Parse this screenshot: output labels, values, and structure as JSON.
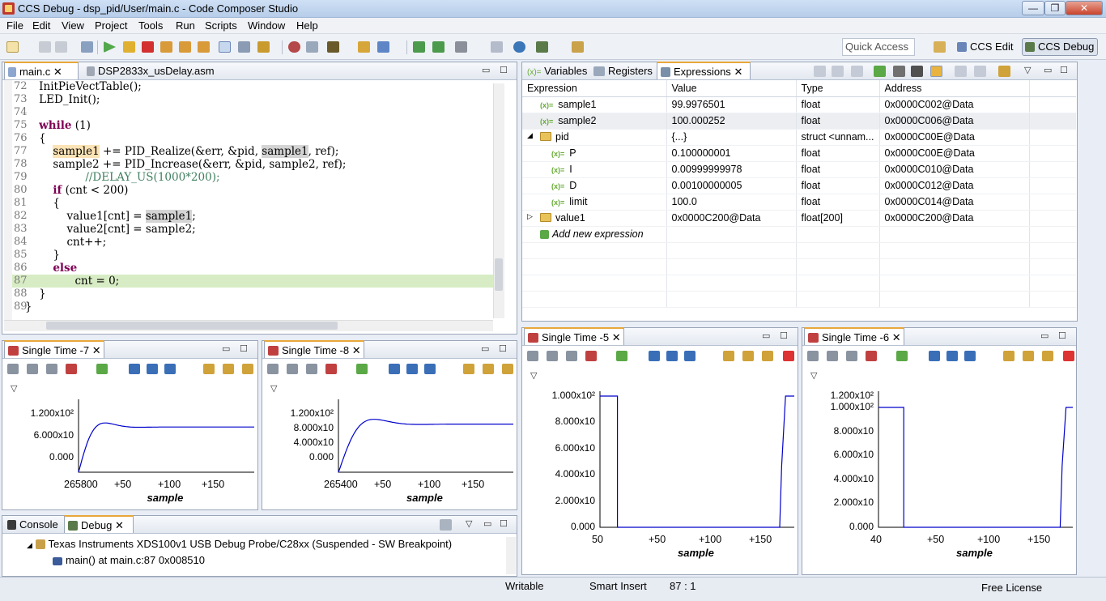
{
  "window": {
    "title": "CCS Debug - dsp_pid/User/main.c - Code Composer Studio"
  },
  "menu": [
    "File",
    "Edit",
    "View",
    "Project",
    "Tools",
    "Run",
    "Scripts",
    "Window",
    "Help"
  ],
  "quick_access": {
    "placeholder": "Quick Access"
  },
  "perspectives": {
    "edit": "CCS Edit",
    "debug": "CCS Debug"
  },
  "editor": {
    "tabs": [
      "main.c",
      "DSP2833x_usDelay.asm"
    ],
    "lines": [
      {
        "n": "72",
        "t": "    InitPieVectTable();"
      },
      {
        "n": "73",
        "t": "    LED_Init();"
      },
      {
        "n": "74",
        "t": ""
      },
      {
        "n": "75",
        "t": "    while (1)"
      },
      {
        "n": "76",
        "t": "    {"
      },
      {
        "n": "77",
        "t": "        sample1 += PID_Realize(&err, &pid, sample1, ref);"
      },
      {
        "n": "78",
        "t": "        sample2 += PID_Increase(&err, &pid, sample2, ref);"
      },
      {
        "n": "79",
        "t": "        //DELAY_US(1000*200);"
      },
      {
        "n": "80",
        "t": "        if (cnt < 200)"
      },
      {
        "n": "81",
        "t": "        {"
      },
      {
        "n": "82",
        "t": "            value1[cnt] = sample1;"
      },
      {
        "n": "83",
        "t": "            value2[cnt] = sample2;"
      },
      {
        "n": "84",
        "t": "            cnt++;"
      },
      {
        "n": "85",
        "t": "        }"
      },
      {
        "n": "86",
        "t": "        else"
      },
      {
        "n": "87",
        "t": "            cnt = 0;"
      },
      {
        "n": "88",
        "t": "    }"
      },
      {
        "n": "89",
        "t": "}"
      }
    ]
  },
  "views": {
    "tabs": [
      "Variables",
      "Registers",
      "Expressions"
    ],
    "columns": [
      "Expression",
      "Value",
      "Type",
      "Address"
    ],
    "rows": [
      {
        "e": "sample1",
        "v": "99.9976501",
        "t": "float",
        "a": "0x0000C002@Data",
        "lvl": 0,
        "kind": "var"
      },
      {
        "e": "sample2",
        "v": "100.000252",
        "t": "float",
        "a": "0x0000C006@Data",
        "lvl": 0,
        "kind": "var"
      },
      {
        "e": "pid",
        "v": "{...}",
        "t": "struct <unnam...",
        "a": "0x0000C00E@Data",
        "lvl": 0,
        "kind": "struct"
      },
      {
        "e": "P",
        "v": "0.100000001",
        "t": "float",
        "a": "0x0000C00E@Data",
        "lvl": 1,
        "kind": "var"
      },
      {
        "e": "I",
        "v": "0.00999999978",
        "t": "float",
        "a": "0x0000C010@Data",
        "lvl": 1,
        "kind": "var"
      },
      {
        "e": "D",
        "v": "0.00100000005",
        "t": "float",
        "a": "0x0000C012@Data",
        "lvl": 1,
        "kind": "var"
      },
      {
        "e": "limit",
        "v": "100.0",
        "t": "float",
        "a": "0x0000C014@Data",
        "lvl": 1,
        "kind": "var"
      },
      {
        "e": "value1",
        "v": "0x0000C200@Data",
        "t": "float[200]",
        "a": "0x0000C200@Data",
        "lvl": 0,
        "kind": "array"
      }
    ],
    "add_new": "Add new expression",
    "var_icon": "(x)="
  },
  "graphs": [
    {
      "tab": "Single Time -7",
      "yticks": [
        "1.200x10²",
        "6.000x10",
        "0.000"
      ],
      "xticks": [
        "265800",
        "+50",
        "+100",
        "+150"
      ],
      "xlabel": "sample"
    },
    {
      "tab": "Single Time -8",
      "yticks": [
        "1.200x10²",
        "8.000x10",
        "4.000x10",
        "0.000"
      ],
      "xticks": [
        "265400",
        "+50",
        "+100",
        "+150"
      ],
      "xlabel": "sample"
    },
    {
      "tab": "Single Time -5",
      "yticks": [
        "1.000x10²",
        "8.000x10",
        "6.000x10",
        "4.000x10",
        "2.000x10",
        "0.000"
      ],
      "xticks": [
        "50",
        "+50",
        "+100",
        "+150"
      ],
      "xlabel": "sample"
    },
    {
      "tab": "Single Time -6",
      "yticks": [
        "1.200x10²",
        "1.000x10²",
        "8.000x10",
        "6.000x10",
        "4.000x10",
        "2.000x10",
        "0.000"
      ],
      "xticks": [
        "40",
        "+50",
        "+100",
        "+150"
      ],
      "xlabel": "sample"
    }
  ],
  "debug": {
    "tabs": [
      "Console",
      "Debug"
    ],
    "target": "Texas Instruments XDS100v1 USB Debug Probe/C28xx (Suspended - SW Breakpoint)",
    "frame": "main() at main.c:87 0x008510"
  },
  "status": {
    "writable": "Writable",
    "insert": "Smart Insert",
    "pos": "87 : 1",
    "license": "Free License"
  },
  "colors": {
    "accent": "#e8a73a",
    "plot": "#0000cc",
    "current_line": "#d7ecc4"
  }
}
